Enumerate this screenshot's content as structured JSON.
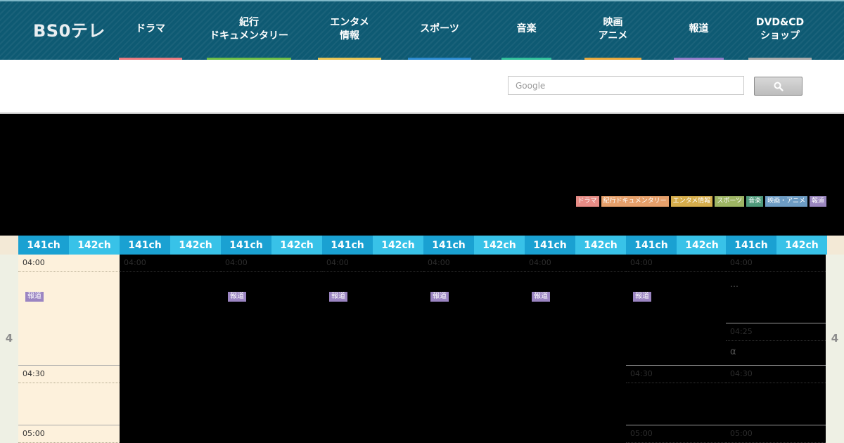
{
  "logo": {
    "text": "BS0テレ"
  },
  "nav": [
    {
      "label": "ドラマ",
      "color": "#e9797f"
    },
    {
      "label": "紀行\nドキュメンタリー",
      "color": "#6cbd45"
    },
    {
      "label": "エンタメ\n情報",
      "color": "#e8c454"
    },
    {
      "label": "スポーツ",
      "color": "#2a8bd1"
    },
    {
      "label": "音楽",
      "color": "#2fbf9a"
    },
    {
      "label": "映画\nアニメ",
      "color": "#e8a83c"
    },
    {
      "label": "報道",
      "color": "#8f7bc8"
    },
    {
      "label": "DVD&CD\nショップ",
      "color": "#a9a9a9"
    }
  ],
  "search": {
    "placeholder": "Google",
    "button_icon": "search-icon"
  },
  "legend": [
    {
      "label": "ドラマ",
      "color": "#e78c86"
    },
    {
      "label": "紀行ドキュメンタリー",
      "color": "#e6a06b"
    },
    {
      "label": "エンタメ情報",
      "color": "#d6ad4c"
    },
    {
      "label": "スポーツ",
      "color": "#9eb564"
    },
    {
      "label": "音楽",
      "color": "#4f9a7b"
    },
    {
      "label": "映画・アニメ",
      "color": "#6d9cc4"
    },
    {
      "label": "報道",
      "color": "#9a86bf"
    }
  ],
  "channels": [
    "141ch",
    "142ch",
    "141ch",
    "142ch",
    "141ch",
    "142ch",
    "141ch",
    "142ch",
    "141ch",
    "142ch",
    "141ch",
    "142ch",
    "141ch",
    "142ch",
    "141ch",
    "142ch"
  ],
  "hour": "4",
  "times": {
    "t0400": "04:00",
    "t0425": "04:25",
    "t0430": "04:30",
    "t0500": "05:00"
  },
  "tag_label": "報道",
  "ellipsis": "…",
  "alpha": "α"
}
